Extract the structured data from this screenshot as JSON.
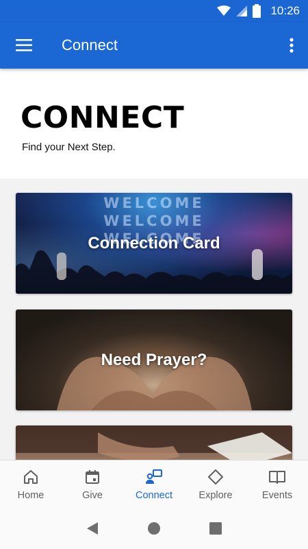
{
  "status_bar": {
    "time": "10:26"
  },
  "app_bar": {
    "title": "Connect"
  },
  "hero": {
    "title": "CONNECT",
    "subtitle": "Find your Next Step."
  },
  "cards": [
    {
      "label": "Connection Card",
      "backdrop_text": [
        "WELCOME",
        "WELCOME",
        "WELCOME"
      ]
    },
    {
      "label": "Need Prayer?"
    },
    {
      "label": ""
    }
  ],
  "bottom_nav": {
    "active": "Connect",
    "items": [
      {
        "label": "Home",
        "icon": "home-icon"
      },
      {
        "label": "Give",
        "icon": "calendar-icon"
      },
      {
        "label": "Connect",
        "icon": "connect-icon"
      },
      {
        "label": "Explore",
        "icon": "diamond-icon"
      },
      {
        "label": "Events",
        "icon": "book-icon"
      }
    ]
  },
  "colors": {
    "primary": "#1b67d3",
    "nav_inactive": "#5f5f5f"
  }
}
